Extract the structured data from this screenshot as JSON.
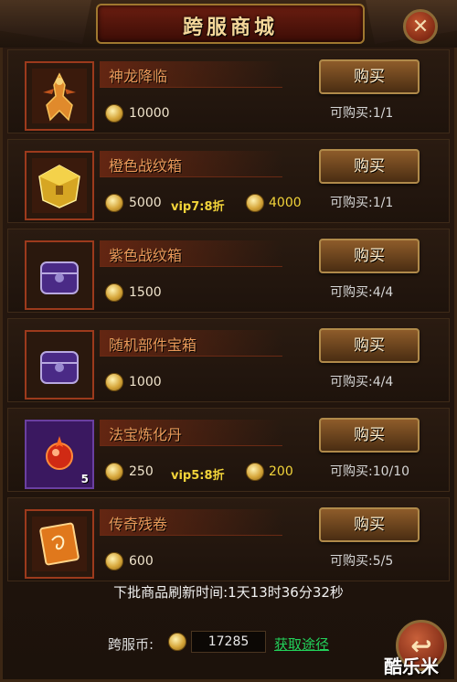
{
  "window": {
    "title": "跨服商城",
    "close_glyph": "✕"
  },
  "buy_label": "购买",
  "items": [
    {
      "name": "神龙降临",
      "price": "10000",
      "limit": "可购买:1/1",
      "icon": "dragon-figure-icon",
      "count": ""
    },
    {
      "name": "橙色战纹箱",
      "price": "5000",
      "vip": "vip7:8折",
      "vip_price": "4000",
      "limit": "可购买:1/1",
      "icon": "orange-chest-icon",
      "count": ""
    },
    {
      "name": "紫色战纹箱",
      "price": "1500",
      "limit": "可购买:4/4",
      "icon": "purple-chest-icon",
      "count": ""
    },
    {
      "name": "随机部件宝箱",
      "price": "1000",
      "limit": "可购买:4/4",
      "icon": "purple-chest-icon",
      "count": ""
    },
    {
      "name": "法宝炼化丹",
      "price": "250",
      "vip": "vip5:8折",
      "vip_price": "200",
      "limit": "可购买:10/10",
      "icon": "red-pill-icon",
      "count": "5"
    },
    {
      "name": "传奇残卷",
      "price": "600",
      "limit": "可购买:5/5",
      "icon": "scroll-icon",
      "count": ""
    }
  ],
  "footer": {
    "refresh_text": "下批商品刷新时间:1天13时36分32秒",
    "currency_label": "跨服币:",
    "currency_value": "17285",
    "get_link": "获取途径",
    "back_glyph": "↩"
  },
  "watermark": "酷乐米",
  "colors": {
    "accent_gold": "#f4d79a",
    "item_name": "#e89a5a",
    "vip": "#f2d43a",
    "link": "#22d15a"
  }
}
